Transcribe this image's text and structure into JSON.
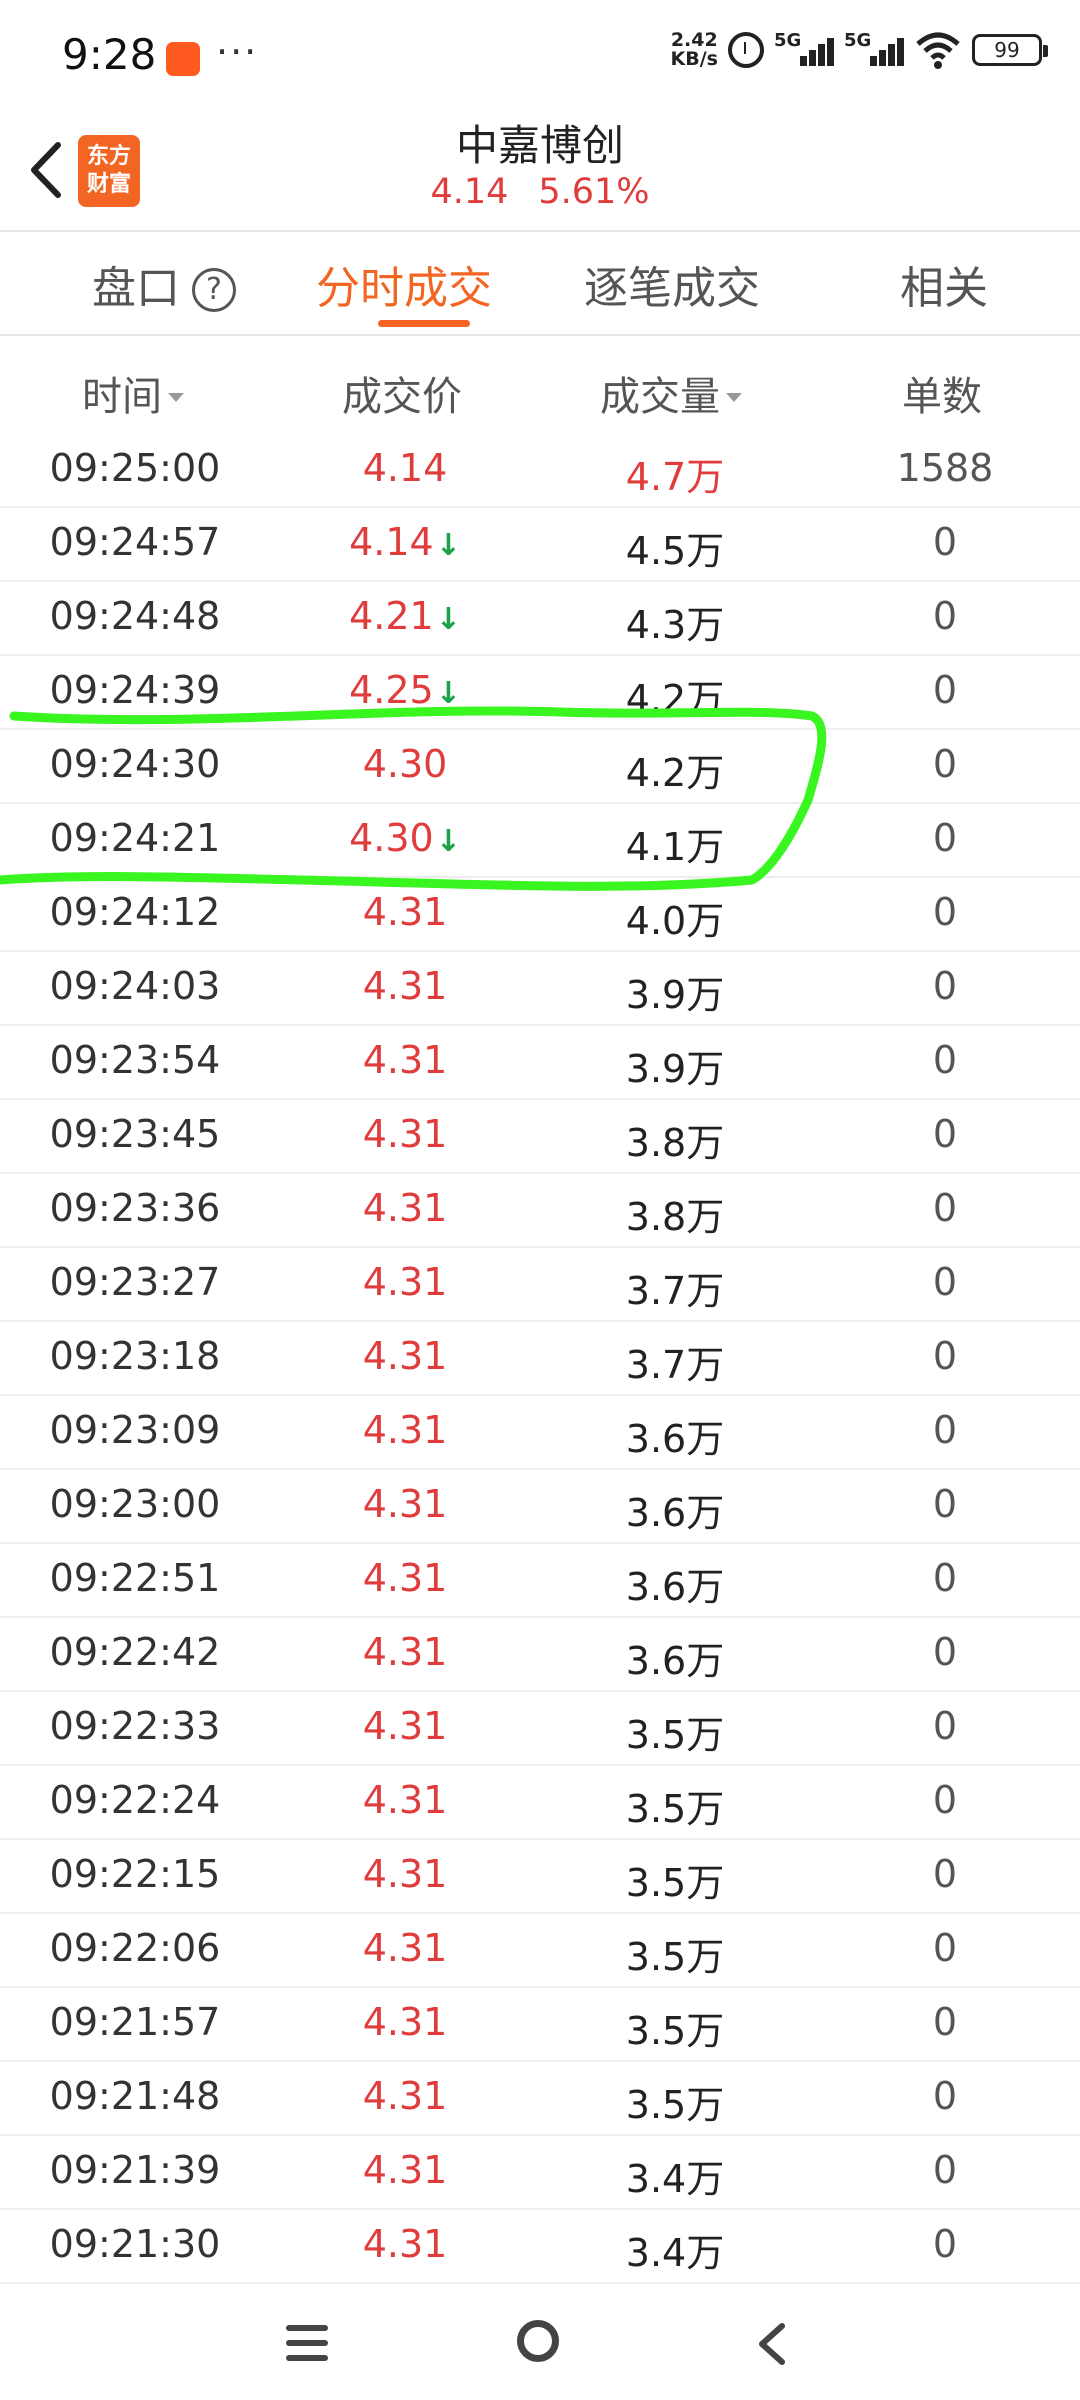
{
  "status_bar": {
    "time": "9:28",
    "dots": "···",
    "net_speed_value": "2.42",
    "net_speed_unit": "KB/s",
    "signal1": "5G",
    "signal2": "5G",
    "battery": "99"
  },
  "header": {
    "logo_text_line1": "东方",
    "logo_text_line2": "财富",
    "stock_name": "中嘉博创",
    "price": "4.14",
    "change_pct": "5.61%"
  },
  "tabs": [
    {
      "label": "盘口"
    },
    {
      "label": "分时成交"
    },
    {
      "label": "逐笔成交"
    },
    {
      "label": "相关"
    }
  ],
  "columns": {
    "time": "时间",
    "price": "成交价",
    "volume": "成交量",
    "count": "单数"
  },
  "rows": [
    {
      "time": "09:25:00",
      "price": "4.14",
      "down": false,
      "volume": "4.7万",
      "count": "1588"
    },
    {
      "time": "09:24:57",
      "price": "4.14",
      "down": true,
      "volume": "4.5万",
      "count": "0"
    },
    {
      "time": "09:24:48",
      "price": "4.21",
      "down": true,
      "volume": "4.3万",
      "count": "0"
    },
    {
      "time": "09:24:39",
      "price": "4.25",
      "down": true,
      "volume": "4.2万",
      "count": "0"
    },
    {
      "time": "09:24:30",
      "price": "4.30",
      "down": false,
      "volume": "4.2万",
      "count": "0"
    },
    {
      "time": "09:24:21",
      "price": "4.30",
      "down": true,
      "volume": "4.1万",
      "count": "0"
    },
    {
      "time": "09:24:12",
      "price": "4.31",
      "down": false,
      "volume": "4.0万",
      "count": "0"
    },
    {
      "time": "09:24:03",
      "price": "4.31",
      "down": false,
      "volume": "3.9万",
      "count": "0"
    },
    {
      "time": "09:23:54",
      "price": "4.31",
      "down": false,
      "volume": "3.9万",
      "count": "0"
    },
    {
      "time": "09:23:45",
      "price": "4.31",
      "down": false,
      "volume": "3.8万",
      "count": "0"
    },
    {
      "time": "09:23:36",
      "price": "4.31",
      "down": false,
      "volume": "3.8万",
      "count": "0"
    },
    {
      "time": "09:23:27",
      "price": "4.31",
      "down": false,
      "volume": "3.7万",
      "count": "0"
    },
    {
      "time": "09:23:18",
      "price": "4.31",
      "down": false,
      "volume": "3.7万",
      "count": "0"
    },
    {
      "time": "09:23:09",
      "price": "4.31",
      "down": false,
      "volume": "3.6万",
      "count": "0"
    },
    {
      "time": "09:23:00",
      "price": "4.31",
      "down": false,
      "volume": "3.6万",
      "count": "0"
    },
    {
      "time": "09:22:51",
      "price": "4.31",
      "down": false,
      "volume": "3.6万",
      "count": "0"
    },
    {
      "time": "09:22:42",
      "price": "4.31",
      "down": false,
      "volume": "3.6万",
      "count": "0"
    },
    {
      "time": "09:22:33",
      "price": "4.31",
      "down": false,
      "volume": "3.5万",
      "count": "0"
    },
    {
      "time": "09:22:24",
      "price": "4.31",
      "down": false,
      "volume": "3.5万",
      "count": "0"
    },
    {
      "time": "09:22:15",
      "price": "4.31",
      "down": false,
      "volume": "3.5万",
      "count": "0"
    },
    {
      "time": "09:22:06",
      "price": "4.31",
      "down": false,
      "volume": "3.5万",
      "count": "0"
    },
    {
      "time": "09:21:57",
      "price": "4.31",
      "down": false,
      "volume": "3.5万",
      "count": "0"
    },
    {
      "time": "09:21:48",
      "price": "4.31",
      "down": false,
      "volume": "3.5万",
      "count": "0"
    },
    {
      "time": "09:21:39",
      "price": "4.31",
      "down": false,
      "volume": "3.4万",
      "count": "0"
    },
    {
      "time": "09:21:30",
      "price": "4.31",
      "down": false,
      "volume": "3.4万",
      "count": "0"
    }
  ],
  "colors": {
    "accent": "#f26522",
    "price_red": "#e03c3c",
    "down_green": "#1aa34a",
    "annotation_green": "#39f520"
  },
  "icons": {
    "back": "chevron-left-icon",
    "help": "question-circle-icon",
    "sort": "caret-down-icon",
    "down": "arrow-down-icon",
    "nav_menu": "menu-icon",
    "nav_home": "circle-home-icon",
    "nav_back": "chevron-back-icon"
  }
}
